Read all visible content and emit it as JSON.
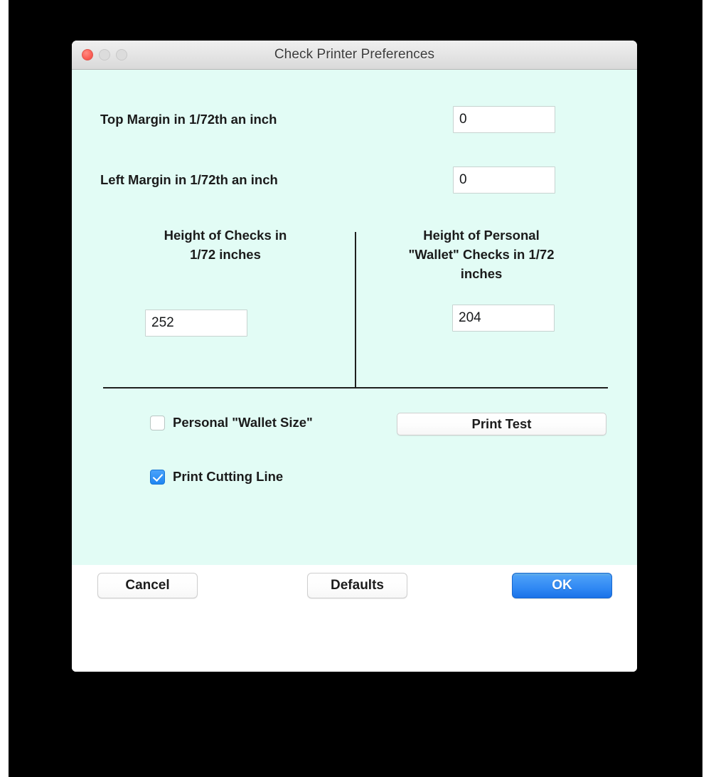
{
  "window": {
    "title": "Check Printer Preferences",
    "traffic_lights": [
      {
        "name": "close",
        "color": "#fc5f57",
        "enabled": true
      },
      {
        "name": "minimize",
        "color": "#dcdcdc",
        "enabled": false
      },
      {
        "name": "zoom",
        "color": "#dcdcdc",
        "enabled": false
      }
    ]
  },
  "theme": {
    "panel_background": "#e2fcf5",
    "footer_background": "#ffffff",
    "accent": "#1e85f2",
    "divider": "#1f1f1f",
    "text": "#1b1b1b"
  },
  "form": {
    "top_margin": {
      "label": "Top Margin in 1/72th an inch",
      "value": "0",
      "placeholder": ""
    },
    "left_margin": {
      "label": "Left Margin in 1/72th an inch",
      "value": "0",
      "placeholder": ""
    },
    "check_height": {
      "heading_line1": "Height of Checks in",
      "heading_line2": "1/72 inches",
      "value": "252",
      "placeholder": ""
    },
    "wallet_height": {
      "heading_line1": "Height of Personal",
      "heading_line2": "\"Wallet\" Checks in 1/72",
      "heading_line3": "inches",
      "value": "204",
      "placeholder": ""
    },
    "wallet_size_checkbox": {
      "label": "Personal \"Wallet Size\"",
      "checked": false
    },
    "cutting_line_checkbox": {
      "label": "Print Cutting Line",
      "checked": true
    },
    "print_test_button": "Print Test"
  },
  "footer": {
    "cancel_label": "Cancel",
    "defaults_label": "Defaults",
    "ok_label": "OK"
  }
}
